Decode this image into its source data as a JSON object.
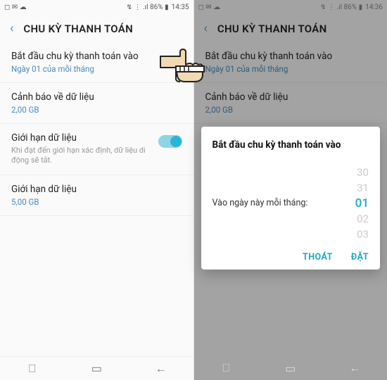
{
  "left": {
    "status": {
      "left_icons": "◻ ✉ ☁",
      "right_icons": "↯ ⋮ .ıl 86% ▮",
      "time": "14:35"
    },
    "header": {
      "title": "CHU KỲ THANH TOÁN"
    },
    "rows": {
      "start": {
        "label": "Bắt đầu chu kỳ thanh toán vào",
        "sub": "Ngày 01 của mỗi tháng"
      },
      "warn": {
        "label": "Cảnh báo về dữ liệu",
        "sub": "2,00 GB"
      },
      "limit_toggle": {
        "label": "Giới hạn dữ liệu",
        "desc": "Khi đạt đến giới hạn xác định, dữ liệu di động sẽ tắt."
      },
      "limit_value": {
        "label": "Giới hạn dữ liệu",
        "sub": "5,00 GB"
      }
    }
  },
  "right": {
    "status": {
      "left_icons": "◻ ✉ ☁",
      "right_icons": "↯ ⋮ .ıl 86% ▮",
      "time": "14:36"
    },
    "header": {
      "title": "CHU KỲ THANH TOÁN"
    },
    "rows": {
      "start": {
        "label": "Bắt đầu chu kỳ thanh toán vào",
        "sub": "Ngày 01 của mỗi tháng"
      },
      "warn": {
        "label": "Cảnh báo về dữ liệu",
        "sub": "2,00 GB"
      }
    },
    "dialog": {
      "title": "Bắt đầu chu kỳ thanh toán vào",
      "prompt": "Vào ngày này mỗi tháng:",
      "picker": {
        "p0": "30",
        "p1": "31",
        "p2": "01",
        "p3": "02",
        "p4": "03"
      },
      "cancel": "THOÁT",
      "ok": "ĐẶT"
    }
  }
}
